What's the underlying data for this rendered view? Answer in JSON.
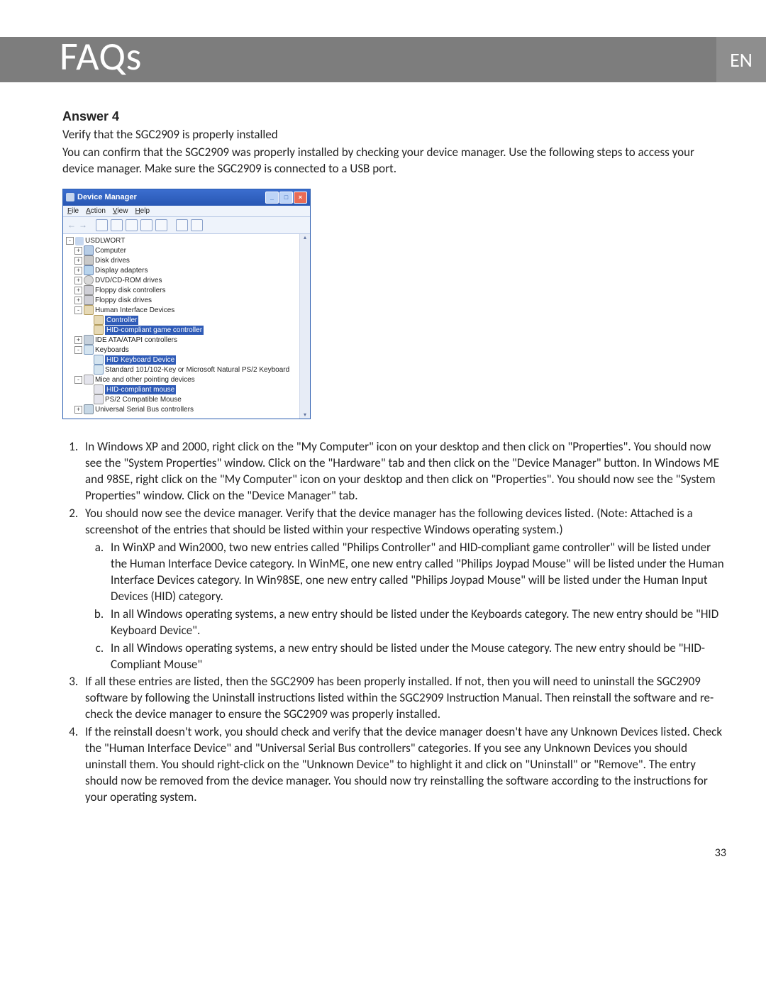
{
  "header": {
    "title": "FAQs",
    "language": "EN"
  },
  "answer": {
    "heading": "Answer 4",
    "verify_line": "Verify that the SGC2909 is properly installed",
    "intro_paragraph": "You can confirm that the SGC2909 was properly installed by checking your device manager. Use the following steps to access your device manager. Make sure the SGC2909 is connected to a USB port."
  },
  "device_manager": {
    "title": "Device Manager",
    "menu": {
      "file": "File",
      "action": "Action",
      "view": "View",
      "help": "Help"
    },
    "root": "USDLWORT",
    "nodes": {
      "computer": "Computer",
      "disk_drives": "Disk drives",
      "display_adapters": "Display adapters",
      "dvd": "DVD/CD-ROM drives",
      "floppy_ctrl": "Floppy disk controllers",
      "floppy_drives": "Floppy disk drives",
      "hid": "Human Interface Devices",
      "controller": "Controller",
      "hid_game": "HID-compliant game controller",
      "ide": "IDE ATA/ATAPI controllers",
      "keyboards": "Keyboards",
      "hid_kb": "HID Keyboard Device",
      "std_kb": "Standard 101/102-Key or Microsoft Natural PS/2 Keyboard",
      "mice": "Mice and other pointing devices",
      "hid_mouse": "HID-compliant mouse",
      "ps2_mouse": "PS/2 Compatible Mouse",
      "usb": "Universal Serial Bus controllers"
    }
  },
  "steps": {
    "s1": "In Windows XP and 2000, right click on the \"My Computer\" icon on your desktop and then click on \"Properties\". You should now see the \"System Properties\" window. Click on the \"Hardware\" tab and then click on the \"Device Manager\" button. In Windows ME and 98SE, right click on the \"My Computer\" icon on your desktop and then click on \"Properties\". You should now see the \"System Properties\" window. Click on the \"Device Manager\" tab.",
    "s2": "You should now see the device manager. Verify that the device manager has the following devices listed. (Note: Attached is a screenshot of the entries that should be listed within your respective Windows operating system.)",
    "s2a": "In WinXP and Win2000, two new entries called \"Philips Controller\" and HID-compliant game controller\" will be listed under the Human Interface Device category. In WinME, one new entry called \"Philips Joypad Mouse\" will be listed under the Human Interface Devices category. In Win98SE, one new entry called \"Philips Joypad Mouse\" will be listed under the Human Input Devices (HID) category.",
    "s2b": "In all Windows operating systems, a new entry should be listed under the Keyboards category. The new entry should be \"HID Keyboard Device\".",
    "s2c": "In all Windows operating systems, a new entry should be listed under the Mouse category. The new entry should be \"HID-Compliant Mouse\"",
    "s3": "If all these entries are listed, then the SGC2909 has been properly installed. If not, then you will need to uninstall the SGC2909 software by following the Uninstall instructions listed within the SGC2909 Instruction Manual. Then reinstall the software and re-check the device manager to ensure the SGC2909 was properly installed.",
    "s4": "If the reinstall doesn't work, you should check and verify that the device manager doesn't have any Unknown Devices listed. Check the \"Human Interface Device\" and \"Universal Serial Bus controllers\" categories. If you see any Unknown Devices you should uninstall them. You should right-click on the \"Unknown Device\" to highlight it and click on \"Uninstall\" or \"Remove\". The entry should now be removed from the device manager. You should now try reinstalling the software according to the instructions for your operating system."
  },
  "page_number": "33"
}
